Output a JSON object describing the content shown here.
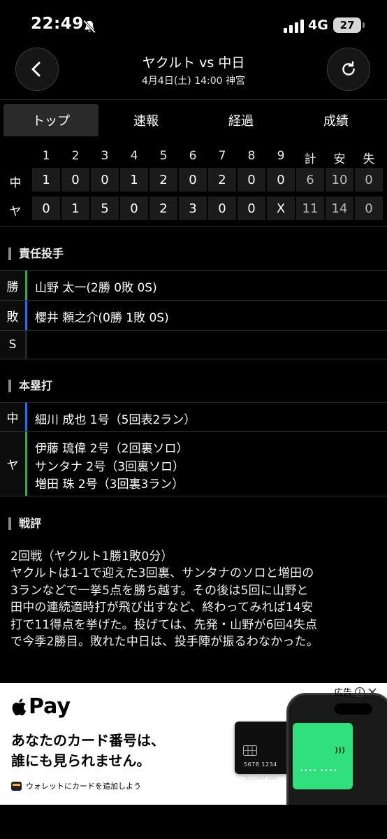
{
  "status_bar": {
    "time": "22:49",
    "network": "4G",
    "battery": "27"
  },
  "header": {
    "title": "ヤクルト vs 中日",
    "subtitle": "4月4日(土) 14:00 神宮"
  },
  "tabs": [
    {
      "label": "トップ",
      "active": true
    },
    {
      "label": "速報",
      "active": false
    },
    {
      "label": "経過",
      "active": false
    },
    {
      "label": "成績",
      "active": false
    }
  ],
  "scoreboard": {
    "headers": [
      "1",
      "2",
      "3",
      "4",
      "5",
      "6",
      "7",
      "8",
      "9",
      "計",
      "安",
      "失"
    ],
    "rows": [
      {
        "team": "中",
        "cells": [
          "1",
          "0",
          "0",
          "1",
          "2",
          "0",
          "2",
          "0",
          "0",
          "6",
          "10",
          "0"
        ]
      },
      {
        "team": "ヤ",
        "cells": [
          "0",
          "1",
          "5",
          "0",
          "2",
          "3",
          "0",
          "0",
          "X",
          "11",
          "14",
          "0"
        ]
      }
    ]
  },
  "pitchers": {
    "heading": "責任投手",
    "rows": [
      {
        "label": "勝",
        "text": "山野 太一(2勝 0敗 0S)",
        "color": "#3ba55c"
      },
      {
        "label": "敗",
        "text": "櫻井 頼之介(0勝 1敗 0S)",
        "color": "#2f6fdc"
      },
      {
        "label": "S",
        "text": "",
        "color": "#0c0c0c"
      }
    ]
  },
  "homeruns": {
    "heading": "本塁打",
    "rows": [
      {
        "label": "中",
        "lines": [
          "細川 成也 1号（5回表2ラン）"
        ],
        "color": "#2f6fdc"
      },
      {
        "label": "ヤ",
        "lines": [
          "伊藤 琉偉 2号（2回裏ソロ）",
          "サンタナ 2号（3回裏ソロ）",
          "増田 珠 2号（3回裏3ラン）"
        ],
        "color": "#3ba55c"
      }
    ]
  },
  "commentary": {
    "heading": "戦評",
    "lines": [
      "2回戦（ヤクルト1勝1敗0分）",
      "ヤクルトは1-1で迎えた3回裏、サンタナのソロと増田の",
      "3ランなどで一挙5点を勝ち越す。その後は5回に山野と",
      "田中の連続適時打が飛び出すなど、終わってみれば14安",
      "打で11得点を挙げた。投げては、先発・山野が6回4失点",
      "で今季2勝目。敗れた中日は、投手陣が振るわなかった。"
    ]
  },
  "ad": {
    "brand": "Pay",
    "headline_1": "あなたのカード番号は、",
    "headline_2": "誰にも見られません。",
    "footer": "ウォレットにカードを追加しよう",
    "label": "広告",
    "card_number": "5678  1234",
    "card_name": "SUSUMU ITAO",
    "phone_dots": "•••• ••••"
  }
}
